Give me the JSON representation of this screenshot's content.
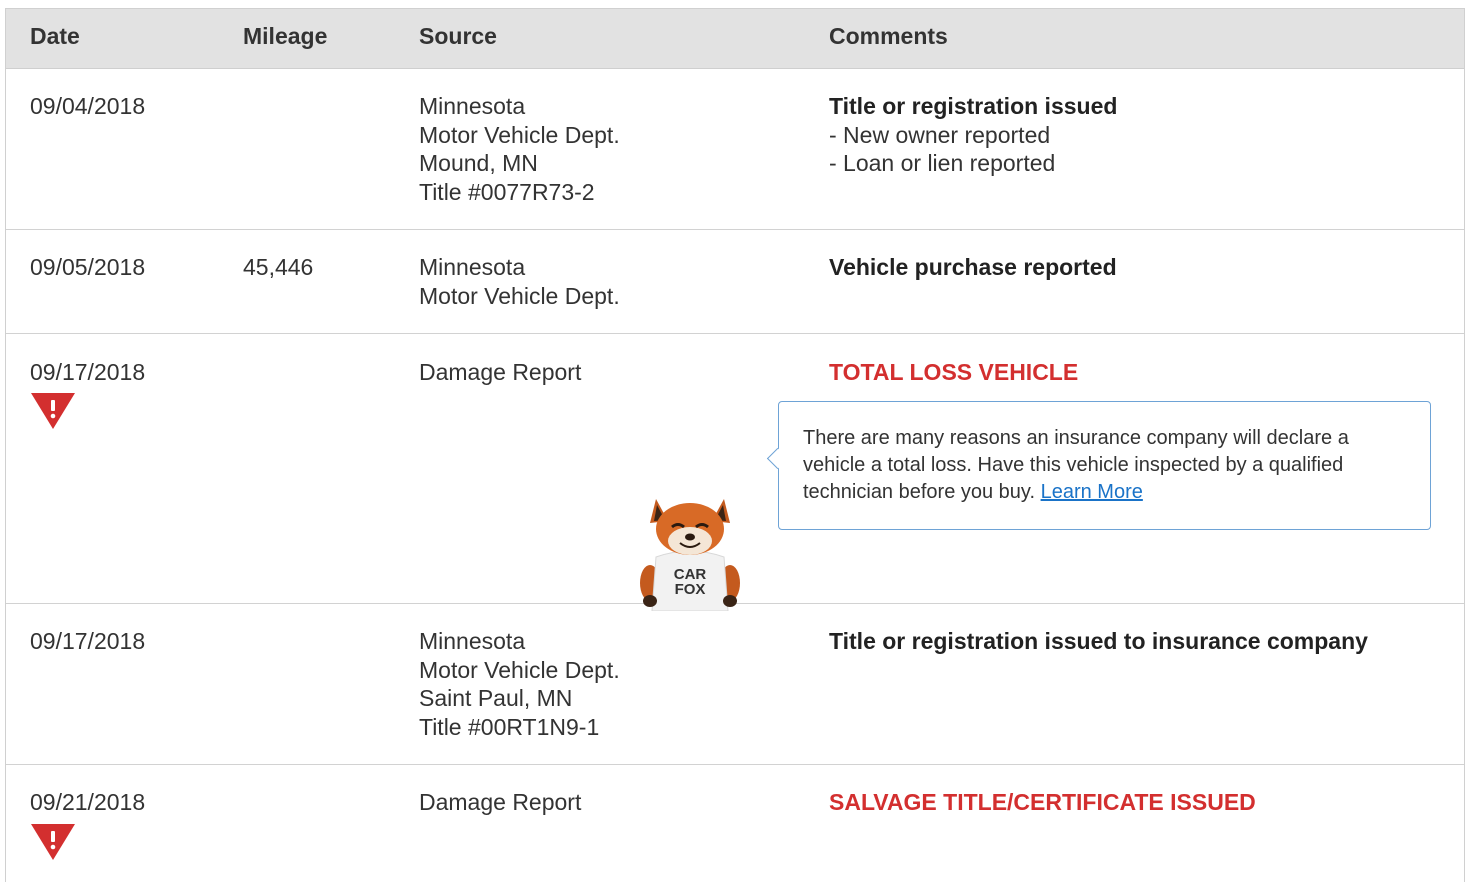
{
  "columns": {
    "date": "Date",
    "mileage": "Mileage",
    "source": "Source",
    "comments": "Comments"
  },
  "rows": [
    {
      "date": "09/04/2018",
      "mileage": "",
      "source": [
        "Minnesota",
        "Motor Vehicle Dept.",
        "Mound, MN",
        "Title #0077R73-2"
      ],
      "comment_title": "Title or registration issued",
      "comment_details": [
        "- New owner reported",
        "- Loan or lien reported"
      ]
    },
    {
      "date": "09/05/2018",
      "mileage": "45,446",
      "source": [
        "Minnesota",
        "Motor Vehicle Dept."
      ],
      "comment_title": "Vehicle purchase reported"
    },
    {
      "date": "09/17/2018",
      "mileage": "",
      "source": [
        "Damage Report"
      ],
      "comment_title": "TOTAL LOSS VEHICLE",
      "alert": true
    },
    {
      "date": "09/17/2018",
      "mileage": "",
      "source": [
        "Minnesota",
        "Motor Vehicle Dept.",
        "Saint Paul, MN",
        "Title #00RT1N9-1"
      ],
      "comment_title": "Title or registration issued to insurance company"
    },
    {
      "date": "09/21/2018",
      "mileage": "",
      "source": [
        "Damage Report"
      ],
      "comment_title": "SALVAGE TITLE/CERTIFICATE ISSUED",
      "alert": true
    }
  ],
  "callout": {
    "text": "There are many reasons an insurance company will declare a vehicle a total loss. Have this vehicle inspected by a qualified technician before you buy.",
    "link_label": "Learn More"
  },
  "mascot": {
    "shirt_line1": "CAR",
    "shirt_line2": "FOX"
  },
  "colors": {
    "alert": "#d32f2f",
    "header_bg": "#e2e2e2",
    "callout_border": "#6ea3d6",
    "link": "#1a73c8"
  },
  "icons": {
    "alert_icon": "warning-triangle-icon"
  }
}
